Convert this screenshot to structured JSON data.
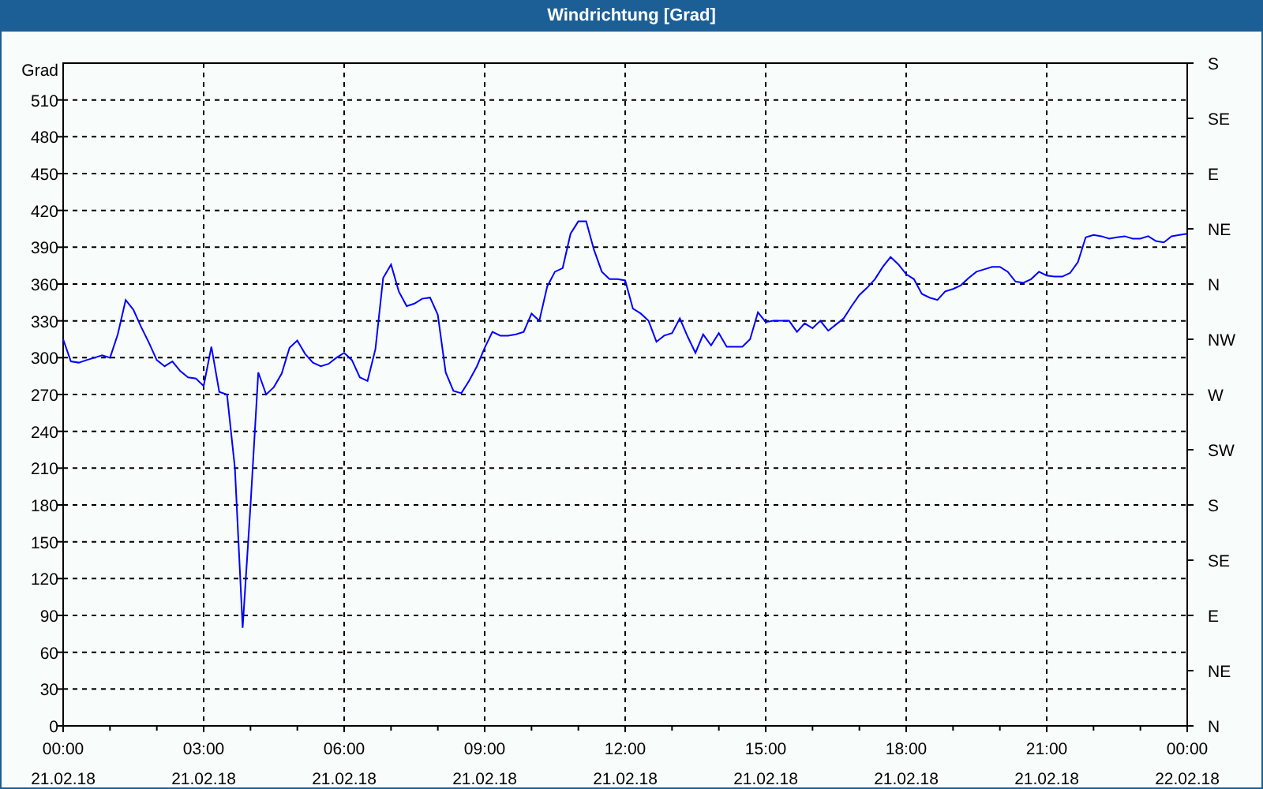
{
  "window": {
    "title": "Windrichtung [Grad]"
  },
  "chart_data": {
    "type": "line",
    "ylabel": "Grad",
    "ylim": [
      0,
      540
    ],
    "grid": true,
    "yticks": [
      0,
      30,
      60,
      90,
      120,
      150,
      180,
      210,
      240,
      270,
      300,
      330,
      360,
      390,
      420,
      450,
      480,
      510
    ],
    "categories": [
      "00:00",
      null,
      null,
      null,
      null,
      null,
      null,
      null,
      null,
      null,
      null,
      null,
      null,
      null,
      null,
      null,
      null,
      null,
      "03:00",
      null,
      null,
      null,
      null,
      null,
      null,
      null,
      null,
      null,
      null,
      null,
      null,
      null,
      null,
      null,
      null,
      null,
      "06:00",
      null,
      null,
      null,
      null,
      null,
      null,
      null,
      null,
      null,
      null,
      null,
      null,
      null,
      null,
      null,
      null,
      null,
      "09:00",
      null,
      null,
      null,
      null,
      null,
      null,
      null,
      null,
      null,
      null,
      null,
      null,
      null,
      null,
      null,
      null,
      null,
      "12:00",
      null,
      null,
      null,
      null,
      null,
      null,
      null,
      null,
      null,
      null,
      null,
      null,
      null,
      null,
      null,
      null,
      null,
      "15:00",
      null,
      null,
      null,
      null,
      null,
      null,
      null,
      null,
      null,
      null,
      null,
      null,
      null,
      null,
      null,
      null,
      null,
      "18:00",
      null,
      null,
      null,
      null,
      null,
      null,
      null,
      null,
      null,
      null,
      null,
      null,
      null,
      null,
      null,
      null,
      null,
      "21:00",
      null,
      null,
      null,
      null,
      null,
      null,
      null,
      null,
      null,
      null,
      null,
      null,
      null,
      null,
      null,
      null,
      null,
      "00:00"
    ],
    "series": [
      {
        "color": "#0000ff",
        "values": [
          315,
          297,
          296,
          298,
          300,
          302,
          300,
          319,
          347,
          339,
          325,
          312,
          298,
          293,
          297,
          289,
          284,
          283,
          277,
          309,
          272,
          270,
          210,
          80,
          180,
          288,
          270,
          276,
          287,
          308,
          314,
          303,
          296,
          293,
          295,
          300,
          304,
          298,
          284,
          281,
          307,
          365,
          376,
          354,
          342,
          344,
          348,
          349,
          335,
          288,
          273,
          271,
          281,
          293,
          308,
          321,
          318,
          318,
          319,
          321,
          336,
          330,
          358,
          370,
          373,
          401,
          411,
          411,
          388,
          370,
          364,
          364,
          363,
          340,
          336,
          330,
          313,
          318,
          320,
          332,
          317,
          304,
          319,
          310,
          320,
          309,
          309,
          309,
          315,
          337,
          329,
          330,
          330,
          330,
          321,
          328,
          324,
          330,
          322,
          327,
          332,
          342,
          351,
          357,
          364,
          374,
          382,
          376,
          368,
          364,
          352,
          349,
          347,
          354,
          356,
          359,
          365,
          370,
          372,
          374,
          374,
          370,
          362,
          361,
          364,
          370,
          367,
          366,
          366,
          369,
          378,
          398,
          400,
          399,
          397,
          398,
          399,
          397,
          397,
          399,
          395,
          394,
          399,
          400,
          401
        ]
      }
    ]
  },
  "compass_axis": [
    "S",
    "SE",
    "E",
    "NE",
    "N",
    "NW",
    "W",
    "SW",
    "S",
    "SE",
    "E",
    "NE",
    "N"
  ],
  "date_labels": [
    "21.02.18",
    "21.02.18",
    "21.02.18",
    "21.02.18",
    "21.02.18",
    "21.02.18",
    "21.02.18",
    "21.02.18",
    "22.02.18"
  ]
}
